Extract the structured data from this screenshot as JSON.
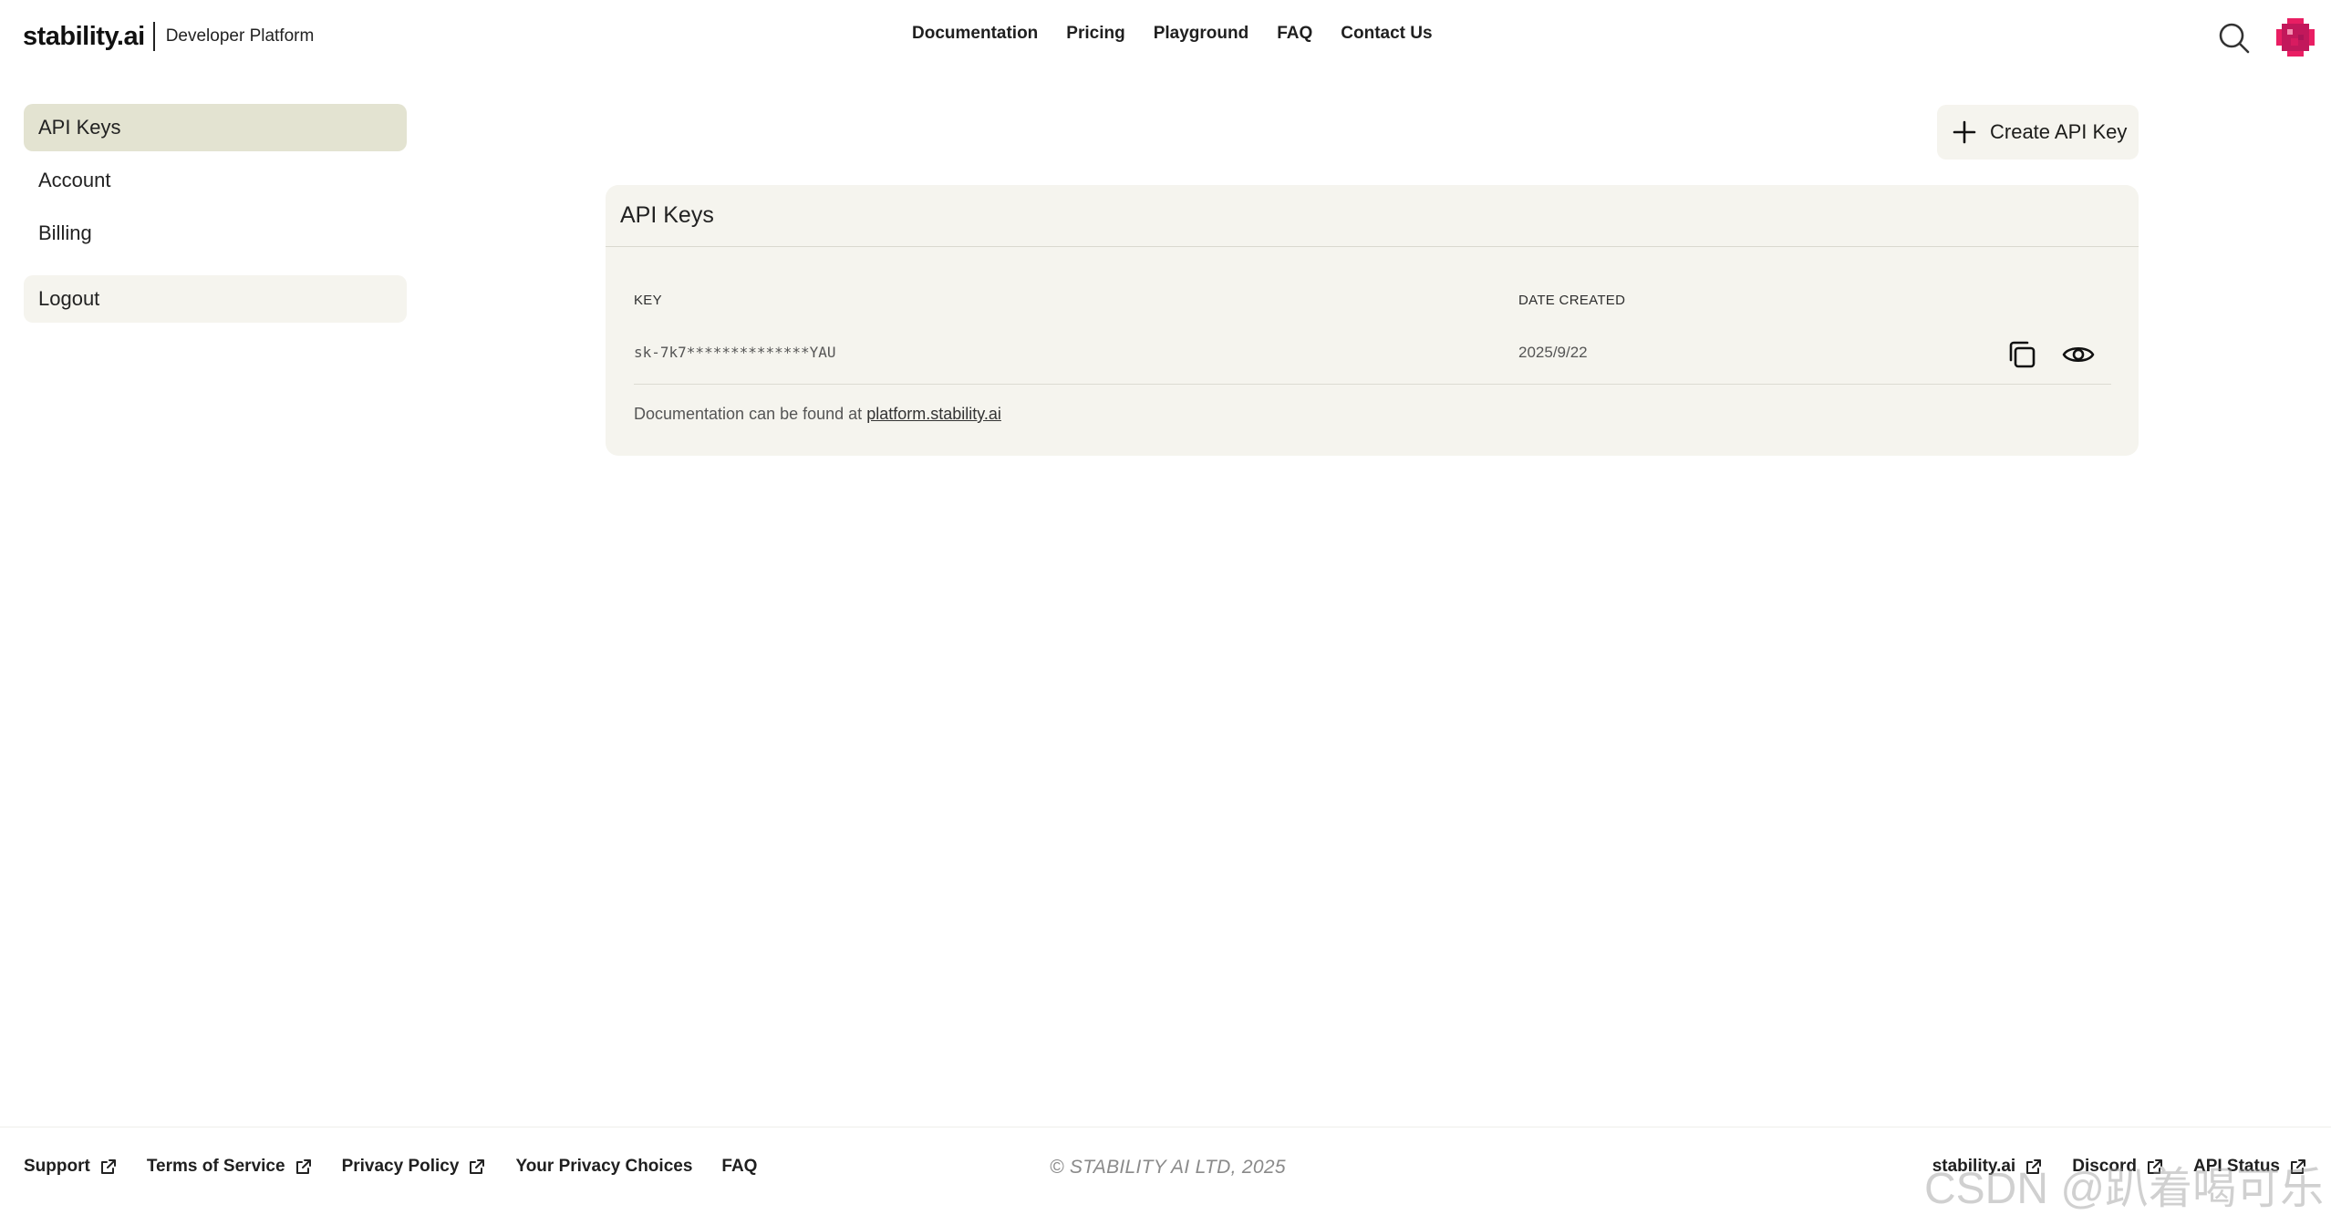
{
  "brand": {
    "logo": "stability.ai",
    "subtitle": "Developer Platform"
  },
  "topnav": {
    "items": [
      "Documentation",
      "Pricing",
      "Playground",
      "FAQ",
      "Contact Us"
    ]
  },
  "header": {
    "search_icon": "search-icon",
    "avatar_color": "#c2185b"
  },
  "sidebar": {
    "items": [
      {
        "label": "API Keys",
        "active": true
      },
      {
        "label": "Account"
      },
      {
        "label": "Billing"
      }
    ],
    "logout_label": "Logout"
  },
  "main": {
    "create_button_label": "Create API Key",
    "card_title": "API Keys",
    "columns": {
      "key": "KEY",
      "date_created": "DATE CREATED"
    },
    "keys": [
      {
        "key": "sk-7k7**************YAU",
        "date": "2025/9/22"
      }
    ],
    "doc_note_prefix": "Documentation can be found at ",
    "doc_link": "platform.stability.ai"
  },
  "footer": {
    "left_links": [
      {
        "label": "Support",
        "external": true
      },
      {
        "label": "Terms of Service",
        "external": true
      },
      {
        "label": "Privacy Policy",
        "external": true
      },
      {
        "label": "Your Privacy Choices",
        "external": false
      },
      {
        "label": "FAQ",
        "external": false
      }
    ],
    "copyright": "© STABILITY AI LTD, 2025",
    "right_links": [
      {
        "label": "stability.ai",
        "external": true
      },
      {
        "label": "Discord",
        "external": true
      },
      {
        "label": "API Status",
        "external": true
      }
    ]
  },
  "watermark": "CSDN @趴着喝可乐",
  "colors": {
    "active_nav_bg": "#e3e3d1",
    "card_bg": "#f5f4ee"
  }
}
